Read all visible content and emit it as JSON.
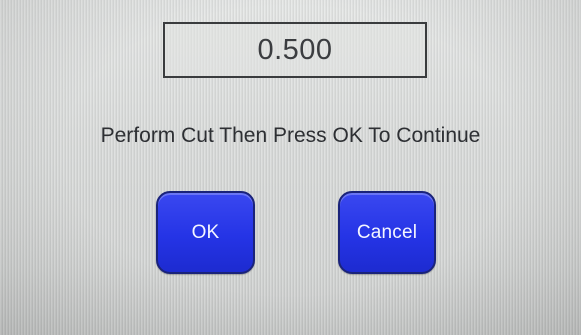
{
  "display": {
    "value": "0.500"
  },
  "prompt": {
    "text": "Perform Cut Then Press OK To Continue"
  },
  "buttons": {
    "ok_label": "OK",
    "cancel_label": "Cancel"
  },
  "colors": {
    "button_blue": "#2534e6",
    "background": "#dcdedd",
    "text": "#2d2f33"
  }
}
